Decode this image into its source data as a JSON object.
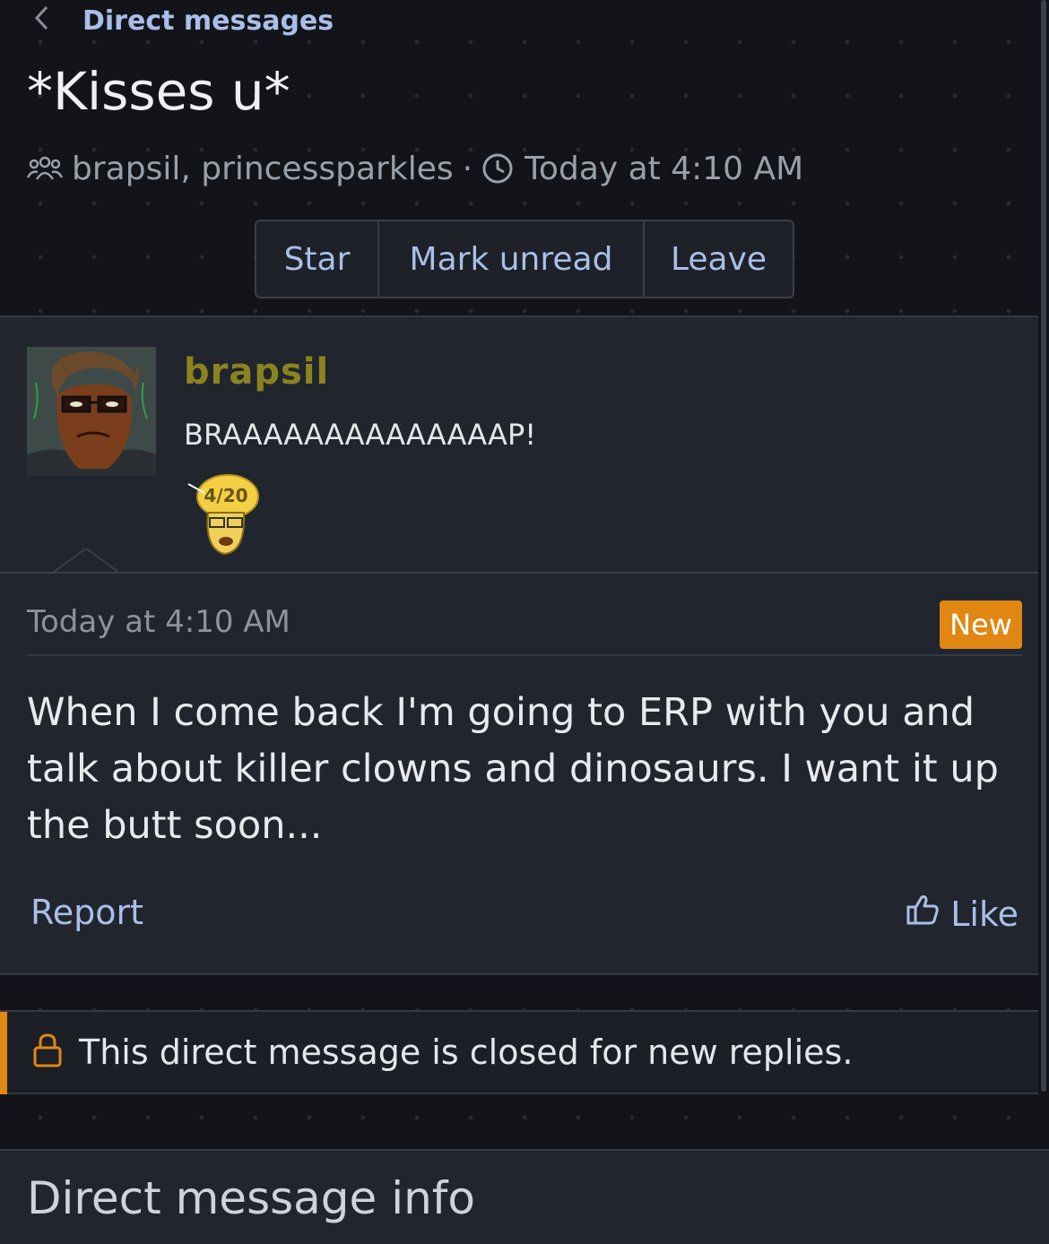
{
  "breadcrumb": {
    "back_icon": "chevron-left-icon",
    "label": "Direct messages"
  },
  "conversation": {
    "title": "*Kisses u*",
    "participants_icon": "users-icon",
    "participants": "brapsil, princessparkles",
    "separator": "·",
    "clock_icon": "clock-icon",
    "time": "Today at 4:10 AM"
  },
  "actions": {
    "star": "Star",
    "mark_unread": "Mark unread",
    "leave": "Leave"
  },
  "message": {
    "author": "brapsil",
    "signature": "BRAAAAAAAAAAAAAAP!",
    "emoji_label": "4/20",
    "timestamp": "Today at 4:10 AM",
    "badge": "New",
    "text": "When I come back I'm going to ERP with you and talk about killer clowns and dinosaurs. I want it up the butt soon...",
    "report": "Report",
    "like": "Like",
    "like_icon": "thumbs-up-icon"
  },
  "notice": {
    "icon": "lock-icon",
    "text": "This direct message is closed for new replies."
  },
  "info": {
    "title": "Direct message info"
  },
  "colors": {
    "accent": "#e08714",
    "link": "#a9bfe8",
    "background": "#121419",
    "panel": "#21252d"
  }
}
